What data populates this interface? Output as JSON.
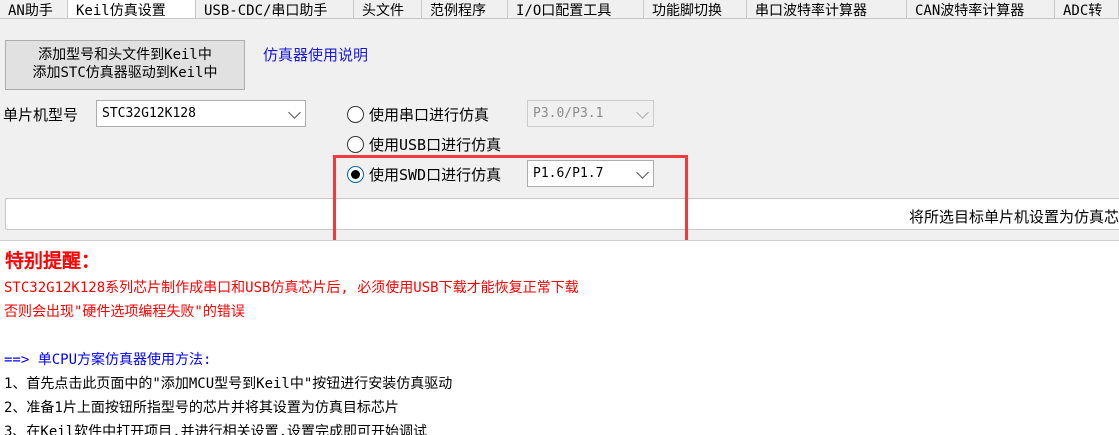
{
  "tabs": [
    {
      "label": "AN助手",
      "width": 68
    },
    {
      "label": "Keil仿真设置",
      "width": 128
    },
    {
      "label": "USB-CDC/串口助手",
      "width": 158
    },
    {
      "label": "头文件",
      "width": 68
    },
    {
      "label": "范例程序",
      "width": 86
    },
    {
      "label": "I/O口配置工具",
      "width": 136
    },
    {
      "label": "功能脚切换",
      "width": 103
    },
    {
      "label": "串口波特率计算器",
      "width": 160
    },
    {
      "label": "CAN波特率计算器",
      "width": 148
    },
    {
      "label": "ADC转",
      "width": 64
    }
  ],
  "buttons": {
    "add_model_line1": "添加型号和头文件到Keil中",
    "add_model_line2": "添加STC仿真器驱动到Keil中",
    "help_link": "仿真器使用说明"
  },
  "mcu": {
    "label": "单片机型号",
    "selected": "STC32G12K128"
  },
  "options": {
    "serial": {
      "label": "使用串口进行仿真",
      "port": "P3.0/P3.1"
    },
    "usb": {
      "label": "使用USB口进行仿真"
    },
    "swd": {
      "label": "使用SWD口进行仿真",
      "port": "P1.6/P1.7"
    }
  },
  "status": {
    "text": "将所选目标单片机设置为仿真芯"
  },
  "notes": {
    "heading": "特别提醒：",
    "warn1": "STC32G12K128系列芯片制作成串口和USB仿真芯片后, 必须使用USB下载才能恢复正常下载",
    "warn2": "否则会出现\"硬件选项编程失败\"的错误",
    "method_title": " ==> 单CPU方案仿真器使用方法:",
    "step1": "1、首先点击此页面中的\"添加MCU型号到Keil中\"按钮进行安装仿真驱动",
    "step2": "2、准备1片上面按钮所指型号的芯片并将其设置为仿真目标芯片",
    "step3": "3、在Keil软件中打开项目,并进行相关设置,设置完成即可开始调试"
  },
  "colors": {
    "highlight": "#ef3b3b",
    "warning_text": "#ff0000",
    "link_text": "#1a1ad6"
  }
}
